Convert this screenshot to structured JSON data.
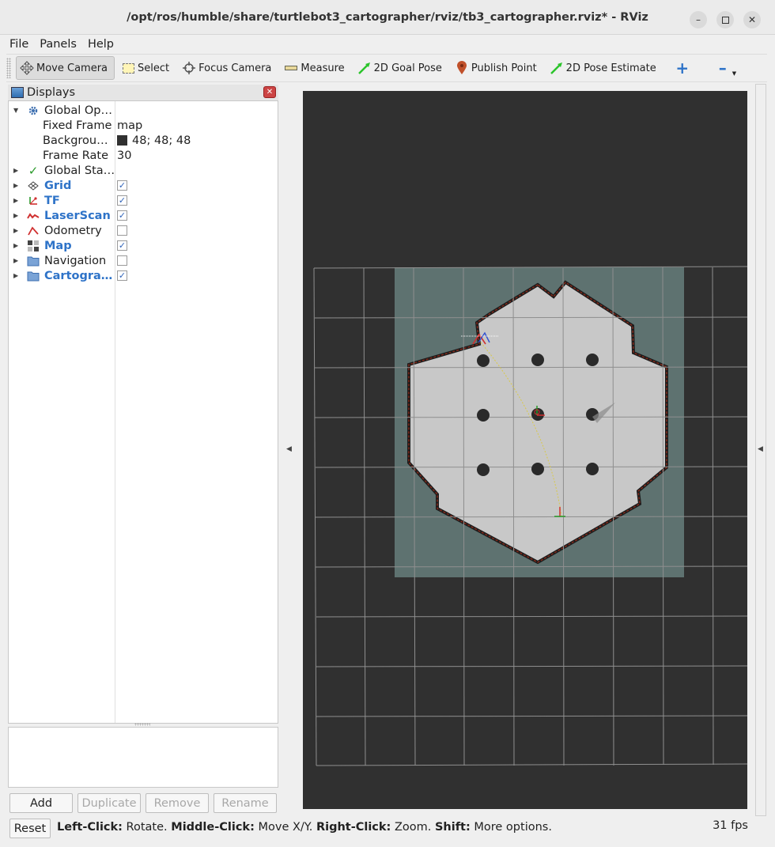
{
  "window": {
    "title": "/opt/ros/humble/share/turtlebot3_cartographer/rviz/tb3_cartographer.rviz* - RViz"
  },
  "menu": [
    "File",
    "Panels",
    "Help"
  ],
  "toolbar": {
    "tools": [
      {
        "label": "Move Camera",
        "icon": "move-camera-icon",
        "active": true
      },
      {
        "label": "Select",
        "icon": "select-icon"
      },
      {
        "label": "Focus Camera",
        "icon": "focus-camera-icon"
      },
      {
        "label": "Measure",
        "icon": "measure-icon"
      },
      {
        "label": "2D Goal Pose",
        "icon": "goal-pose-arrow-icon"
      },
      {
        "label": "Publish Point",
        "icon": "map-pin-icon"
      },
      {
        "label": "2D Pose Estimate",
        "icon": "pose-estimate-arrow-icon"
      }
    ]
  },
  "displays": {
    "title": "Displays",
    "tree": [
      {
        "name": "Global Op…",
        "icon": "gear-icon",
        "expanded": true
      },
      {
        "name": "Fixed Frame",
        "value": "map",
        "child": true
      },
      {
        "name": "Backgrou…",
        "value": "48; 48; 48",
        "color": "#303030",
        "child": true
      },
      {
        "name": "Frame Rate",
        "value": "30",
        "child": true
      },
      {
        "name": "Global Sta…",
        "icon": "check-icon"
      },
      {
        "name": "Grid",
        "icon": "grid-icon",
        "checked": true,
        "highlight": true
      },
      {
        "name": "TF",
        "icon": "tf-icon",
        "checked": true,
        "highlight": true
      },
      {
        "name": "LaserScan",
        "icon": "laserscan-icon",
        "checked": true,
        "highlight": true
      },
      {
        "name": "Odometry",
        "icon": "odometry-icon",
        "checked": false
      },
      {
        "name": "Map",
        "icon": "map-icon",
        "checked": true,
        "highlight": true
      },
      {
        "name": "Navigation",
        "icon": "folder-icon",
        "checked": false
      },
      {
        "name": "Cartogra…",
        "icon": "folder-icon",
        "checked": true,
        "highlight": true
      }
    ],
    "buttons": {
      "add": "Add",
      "duplicate": "Duplicate",
      "remove": "Remove",
      "rename": "Rename"
    }
  },
  "status": {
    "reset": "Reset",
    "hint_parts": [
      {
        "b": "Left-Click:",
        "t": " Rotate. "
      },
      {
        "b": "Middle-Click:",
        "t": " Move X/Y. "
      },
      {
        "b": "Right-Click:",
        "t": " Zoom. "
      },
      {
        "b": "Shift:",
        "t": " More options."
      }
    ],
    "fps": "31 fps"
  },
  "colors": {
    "viewport_bg": "#303030",
    "map_free": "#c9c9c9",
    "map_unknown": "#5f7270",
    "highlight_text": "#2e73c8"
  }
}
